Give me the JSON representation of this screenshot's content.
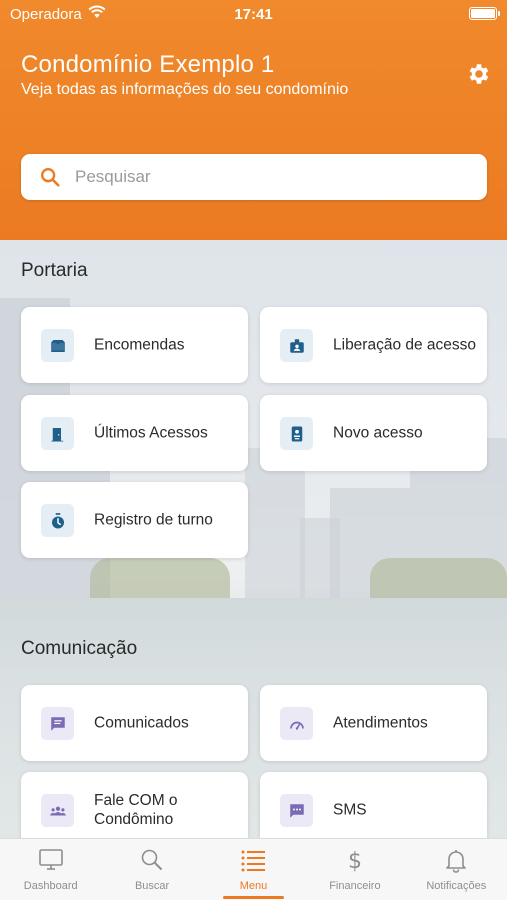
{
  "status_bar": {
    "carrier": "Operadora",
    "time": "17:41"
  },
  "header": {
    "title": "Condomínio Exemplo 1",
    "subtitle": "Veja todas as informações do seu condomínio"
  },
  "search": {
    "placeholder": "Pesquisar",
    "value": ""
  },
  "sections": {
    "portaria": {
      "title": "Portaria",
      "items": [
        {
          "label": "Encomendas",
          "icon": "package-icon"
        },
        {
          "label": "Liberação de acesso",
          "icon": "id-badge-icon"
        },
        {
          "label": "Últimos Acessos",
          "icon": "door-icon"
        },
        {
          "label": "Novo acesso",
          "icon": "contact-card-icon"
        },
        {
          "label": "Registro de turno",
          "icon": "stopwatch-icon"
        }
      ]
    },
    "comunicacao": {
      "title": "Comunicação",
      "items": [
        {
          "label": "Comunicados",
          "icon": "message-icon"
        },
        {
          "label": "Atendimentos",
          "icon": "support-gauge-icon"
        },
        {
          "label": "Fale COM o Condômino",
          "icon": "group-icon"
        },
        {
          "label": "SMS",
          "icon": "sms-icon"
        }
      ]
    }
  },
  "tabbar": {
    "active": "Menu",
    "items": [
      {
        "label": "Dashboard",
        "icon": "monitor-icon"
      },
      {
        "label": "Buscar",
        "icon": "search-icon"
      },
      {
        "label": "Menu",
        "icon": "menu-list-icon"
      },
      {
        "label": "Financeiro",
        "icon": "dollar-icon"
      },
      {
        "label": "Notificações",
        "icon": "bell-icon"
      }
    ]
  },
  "colors": {
    "accent": "#ec7a22",
    "portaria_icon": "#1f5f8b",
    "comunicacao_icon": "#7b6bb5"
  }
}
